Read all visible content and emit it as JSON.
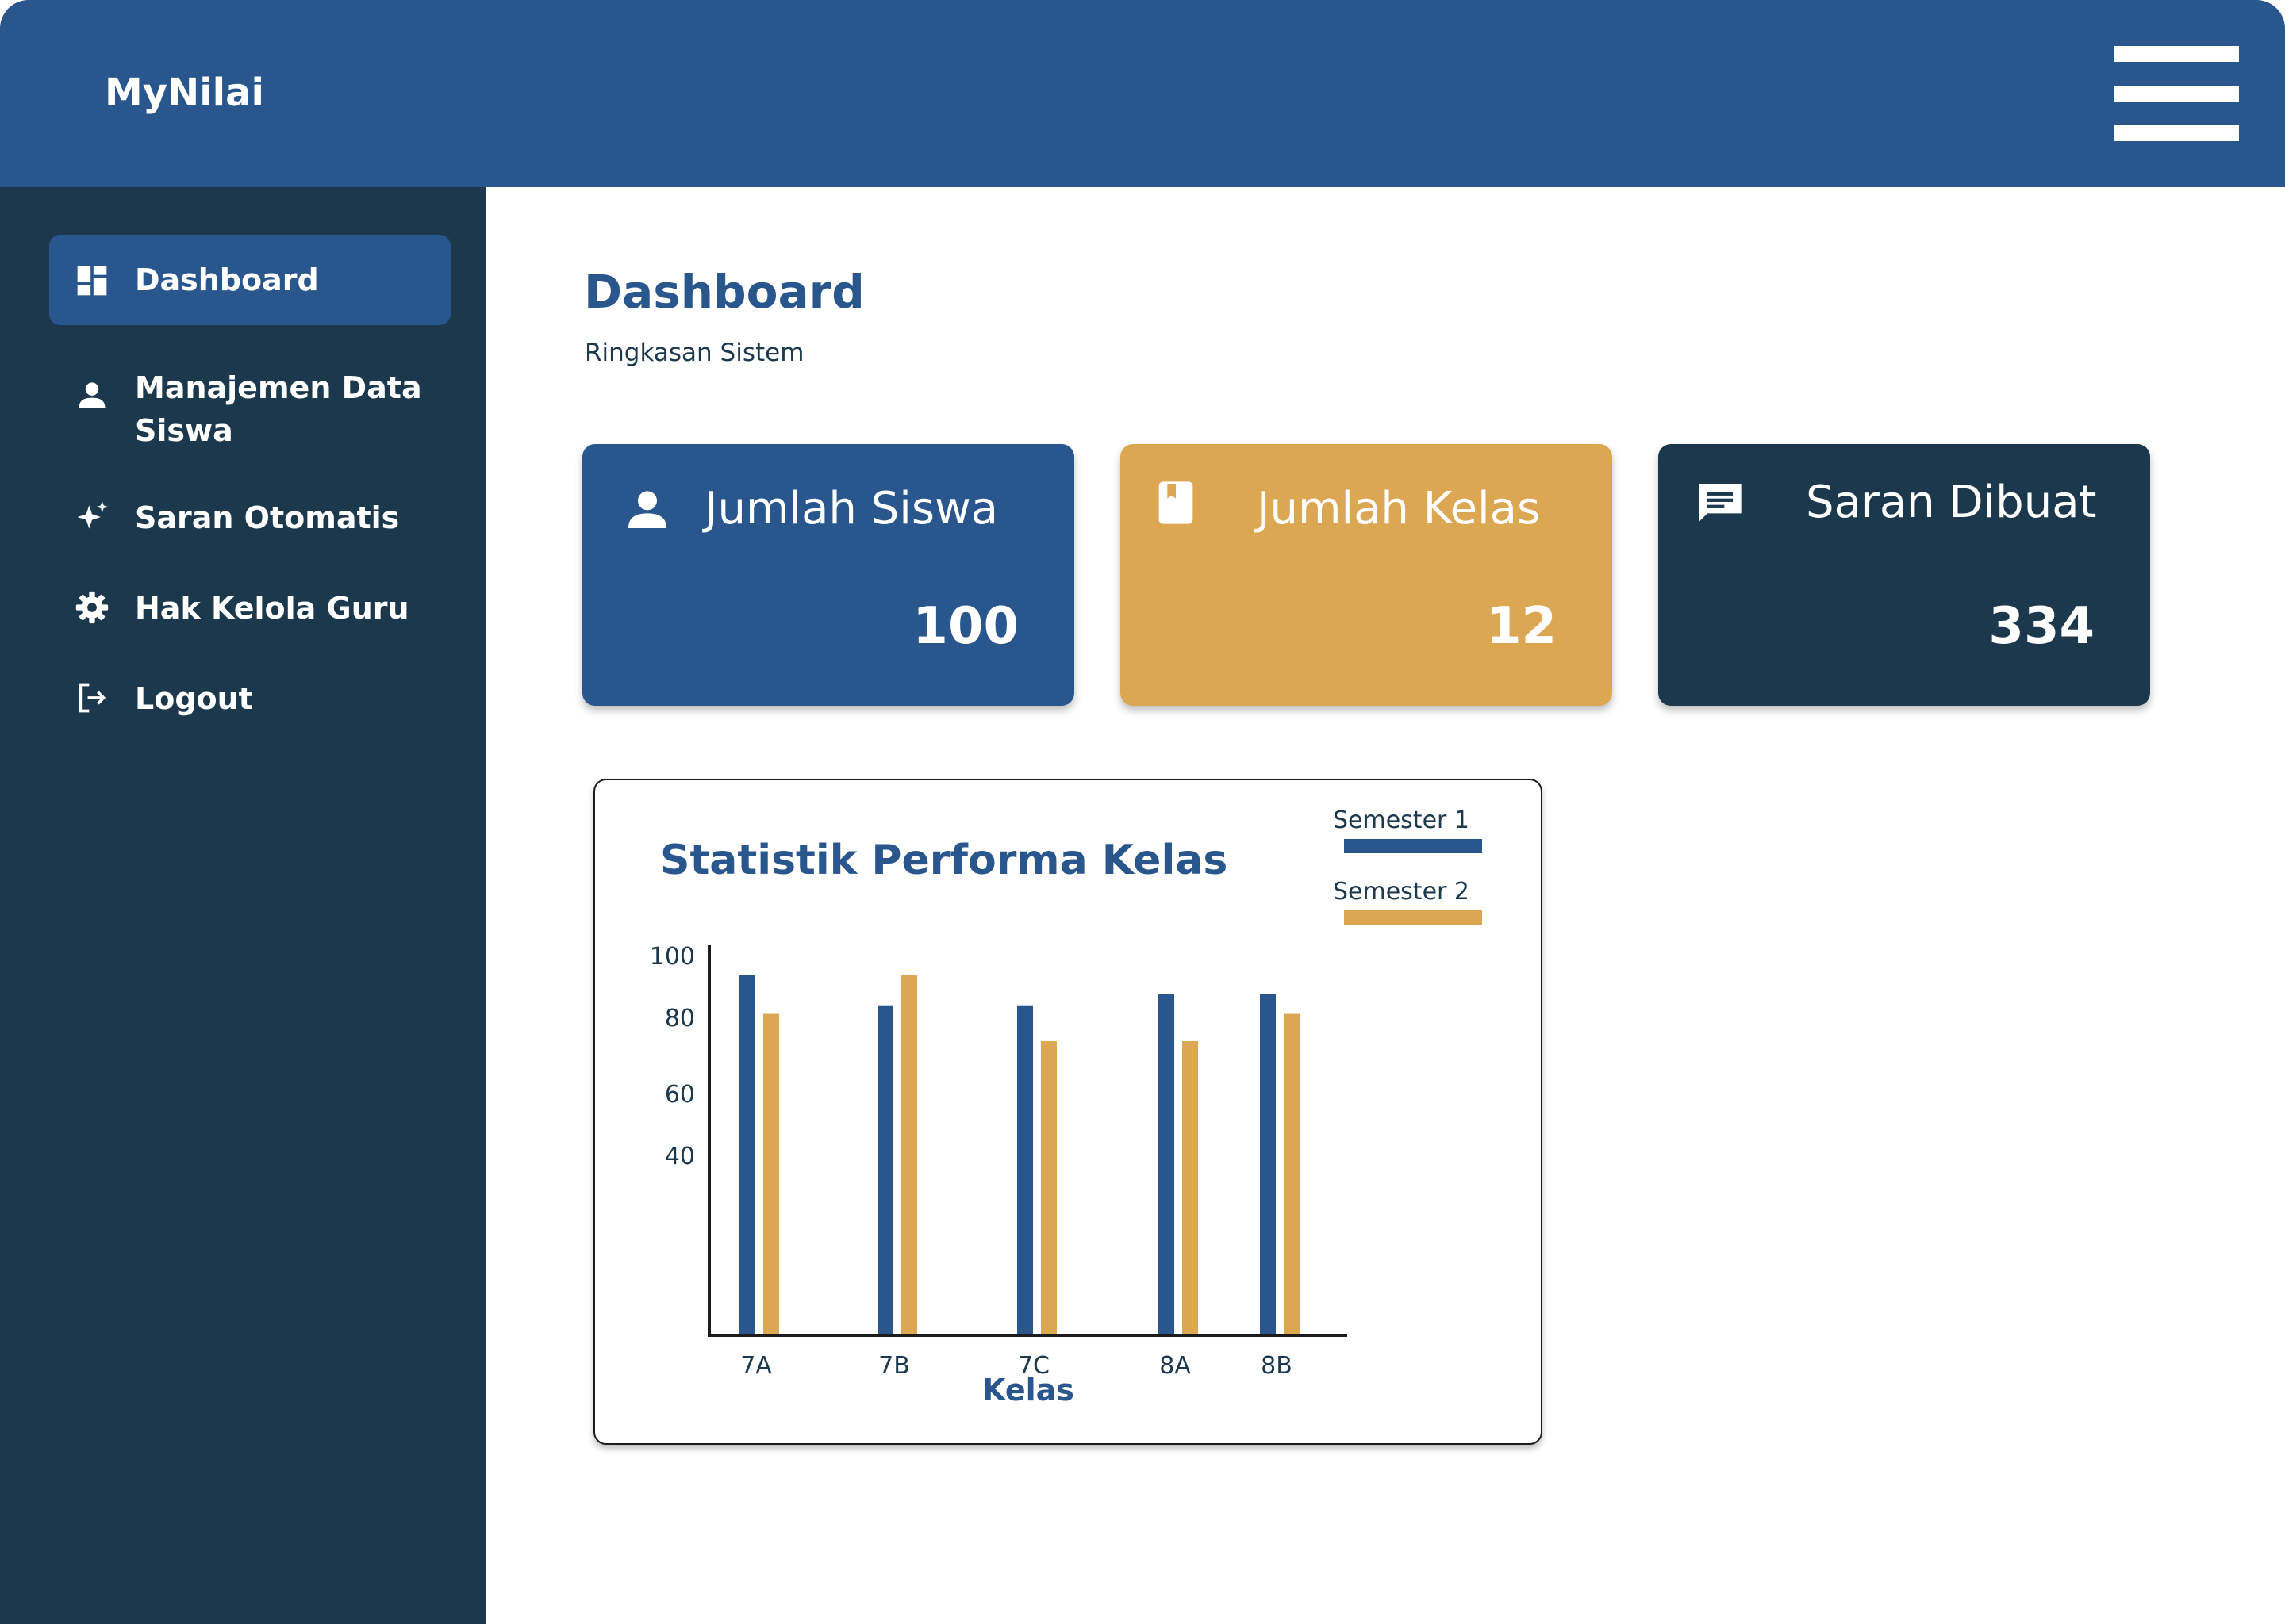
{
  "app": {
    "brand": "MyNilai"
  },
  "sidebar": {
    "items": [
      {
        "label": "Dashboard",
        "icon": "dashboard-icon",
        "active": true
      },
      {
        "label": "Manajemen Data Siswa",
        "icon": "user-icon",
        "active": false
      },
      {
        "label": "Saran Otomatis",
        "icon": "sparkle-icon",
        "active": false
      },
      {
        "label": "Hak Kelola Guru",
        "icon": "gear-icon",
        "active": false
      },
      {
        "label": "Logout",
        "icon": "logout-icon",
        "active": false
      }
    ]
  },
  "page": {
    "title": "Dashboard",
    "subtitle": "Ringkasan Sistem"
  },
  "cards": [
    {
      "label": "Jumlah Siswa",
      "value": "100",
      "icon": "user-icon",
      "color": "#29568c"
    },
    {
      "label": "Jumlah Kelas",
      "value": "12",
      "icon": "book-icon",
      "color": "#dca753"
    },
    {
      "label": "Saran Dibuat",
      "value": "334",
      "icon": "message-icon",
      "color": "#1b384d"
    }
  ],
  "colors": {
    "primary": "#29568c",
    "accent": "#dca753",
    "dark": "#1b384d"
  },
  "chart_data": {
    "type": "bar",
    "title": "Statistik Performa Kelas",
    "xlabel": "Kelas",
    "ylabel": "",
    "categories": [
      "7A",
      "7B",
      "7C",
      "8A",
      "8B"
    ],
    "series": [
      {
        "name": "Semester 1",
        "values": [
          92,
          84,
          84,
          87,
          87
        ],
        "color": "#29568c"
      },
      {
        "name": "Semester 2",
        "values": [
          82,
          92,
          75,
          75,
          82
        ],
        "color": "#dca753"
      }
    ],
    "yticks": [
      "100",
      "80",
      "60",
      "40"
    ],
    "legend": "top-right",
    "grid": false
  }
}
